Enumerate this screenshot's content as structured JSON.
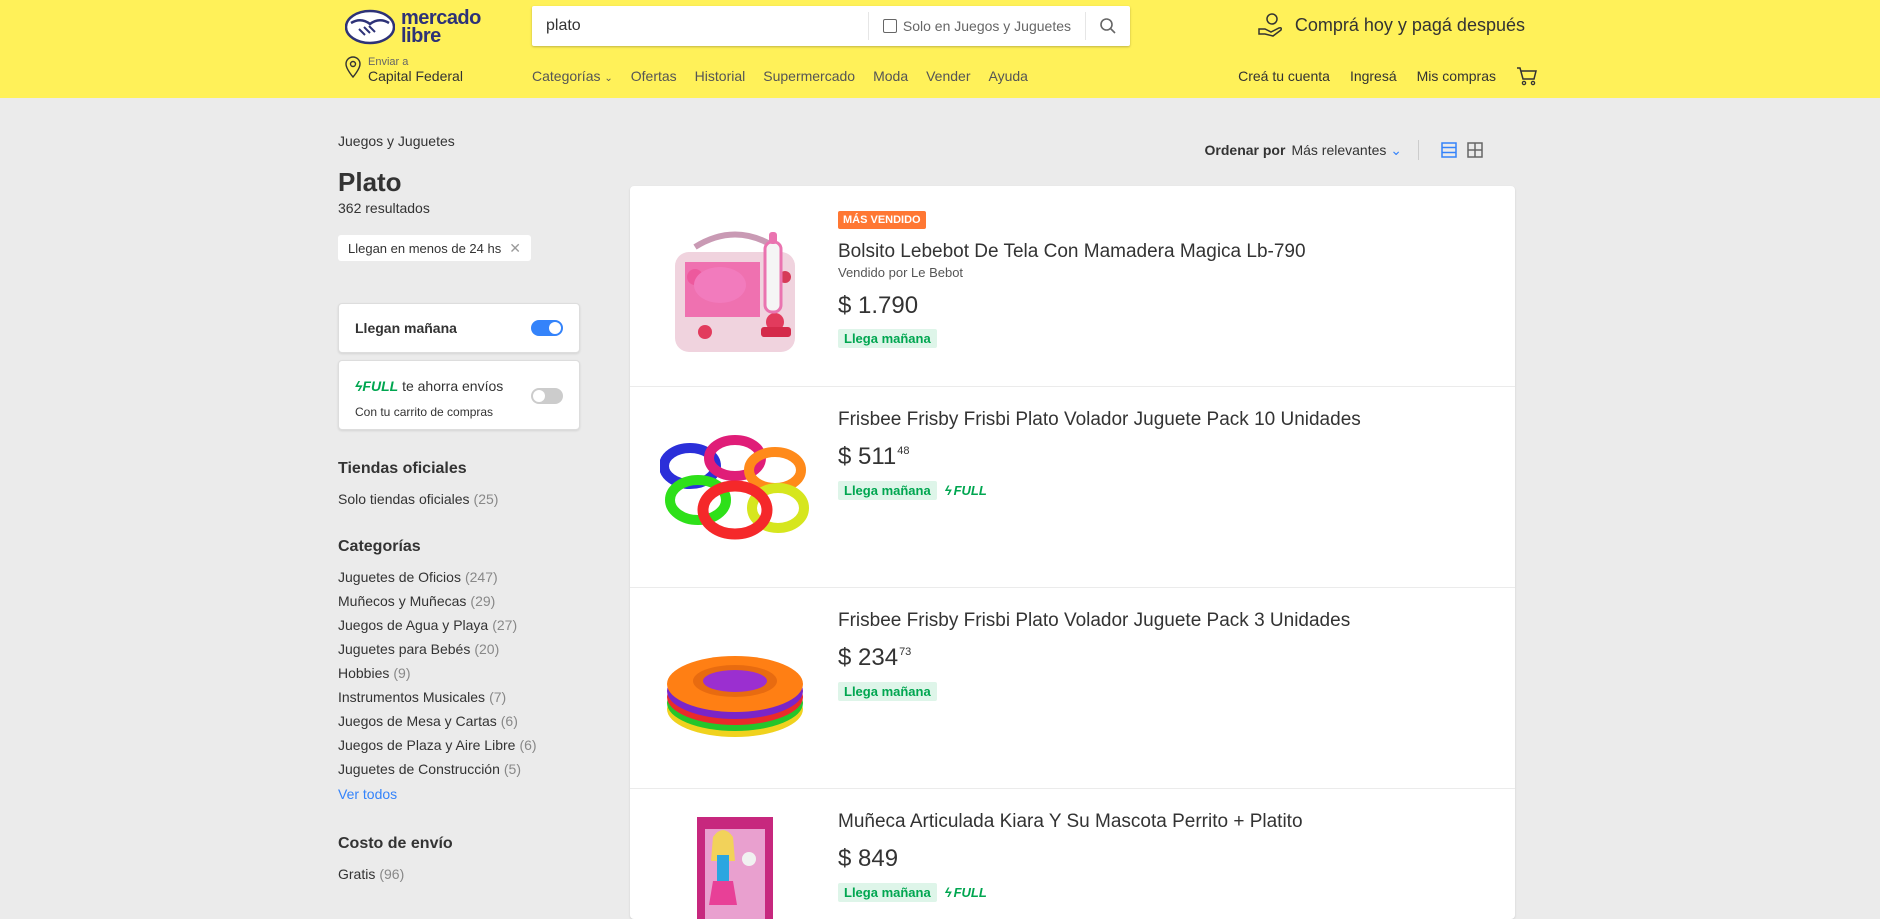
{
  "header": {
    "logo_line1": "mercado",
    "logo_line2": "libre",
    "search_value": "plato",
    "search_filter_label": "Solo en Juegos y Juguetes",
    "promo": "Comprá hoy y pagá después",
    "location_label": "Enviar a",
    "location_value": "Capital Federal",
    "nav": [
      "Categorías",
      "Ofertas",
      "Historial",
      "Supermercado",
      "Moda",
      "Vender",
      "Ayuda"
    ],
    "user_nav": [
      "Creá tu cuenta",
      "Ingresá",
      "Mis compras"
    ]
  },
  "sidebar": {
    "breadcrumb": "Juegos y Juguetes",
    "title": "Plato",
    "results_count": "362 resultados",
    "applied_filter": "Llegan en menos de 24 hs",
    "toggle_tomorrow": "Llegan mañana",
    "toggle_full_badge": "FULL",
    "toggle_full_text": "te ahorra envíos",
    "toggle_full_sub": "Con tu carrito de compras",
    "official_title": "Tiendas oficiales",
    "official_item": {
      "label": "Solo tiendas oficiales",
      "count": "(25)"
    },
    "categories_title": "Categorías",
    "categories": [
      {
        "label": "Juguetes de Oficios",
        "count": "(247)"
      },
      {
        "label": "Muñecos y Muñecas",
        "count": "(29)"
      },
      {
        "label": "Juegos de Agua y Playa",
        "count": "(27)"
      },
      {
        "label": "Juguetes para Bebés",
        "count": "(20)"
      },
      {
        "label": "Hobbies",
        "count": "(9)"
      },
      {
        "label": "Instrumentos Musicales",
        "count": "(7)"
      },
      {
        "label": "Juegos de Mesa y Cartas",
        "count": "(6)"
      },
      {
        "label": "Juegos de Plaza y Aire Libre",
        "count": "(6)"
      },
      {
        "label": "Juguetes de Construcción",
        "count": "(5)"
      }
    ],
    "see_all": "Ver todos",
    "shipping_title": "Costo de envío",
    "shipping_item": {
      "label": "Gratis",
      "count": "(96)"
    }
  },
  "sort": {
    "label": "Ordenar por",
    "value": "Más relevantes"
  },
  "results": [
    {
      "badge": "MÁS VENDIDO",
      "title": "Bolsito Lebebot De Tela Con Mamadera Magica Lb-790",
      "seller": "Vendido por Le Bebot",
      "price": "$ 1.790",
      "cents": "",
      "shipping": "Llega mañana",
      "full": ""
    },
    {
      "badge": "",
      "title": "Frisbee Frisby Frisbi Plato Volador Juguete Pack 10 Unidades",
      "seller": "",
      "price": "$ 511",
      "cents": "48",
      "shipping": "Llega mañana",
      "full": "FULL"
    },
    {
      "badge": "",
      "title": "Frisbee Frisby Frisbi Plato Volador Juguete Pack 3 Unidades",
      "seller": "",
      "price": "$ 234",
      "cents": "73",
      "shipping": "Llega mañana",
      "full": ""
    },
    {
      "badge": "",
      "title": "Muñeca Articulada Kiara Y Su Mascota Perrito + Platito",
      "seller": "",
      "price": "$ 849",
      "cents": "",
      "shipping": "Llega mañana",
      "full": "FULL"
    }
  ],
  "colors": {
    "brand_yellow": "#fff159",
    "accent_blue": "#3483fa",
    "shipping_green": "#00a650",
    "badge_orange": "#ff7733"
  }
}
